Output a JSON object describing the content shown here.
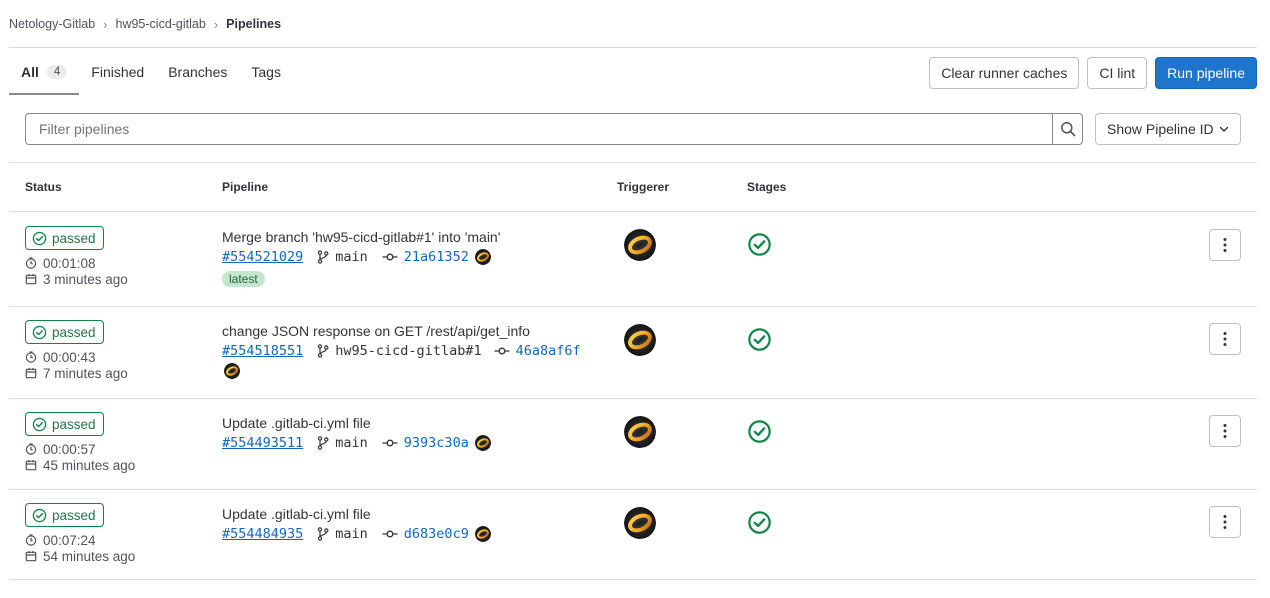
{
  "breadcrumb": [
    "Netology-Gitlab",
    "hw95-cicd-gitlab",
    "Pipelines"
  ],
  "tabs": [
    {
      "label": "All",
      "count": "4"
    },
    {
      "label": "Finished"
    },
    {
      "label": "Branches"
    },
    {
      "label": "Tags"
    }
  ],
  "actions": {
    "clear_caches": "Clear runner caches",
    "ci_lint": "CI lint",
    "run_pipeline": "Run pipeline"
  },
  "filter": {
    "placeholder": "Filter pipelines",
    "sort_label": "Show Pipeline ID"
  },
  "table": {
    "headers": [
      "Status",
      "Pipeline",
      "Triggerer",
      "Stages"
    ],
    "rows": [
      {
        "status": "passed",
        "duration": "00:01:08",
        "finished": "3 minutes ago",
        "title": "Merge branch 'hw95-cicd-gitlab#1' into 'main'",
        "id": "#554521029",
        "ref": "main",
        "sha": "21a61352",
        "badge": "latest"
      },
      {
        "status": "passed",
        "duration": "00:00:43",
        "finished": "7 minutes ago",
        "title": "change JSON response on GET /rest/api/get_info",
        "id": "#554518551",
        "ref": "hw95-cicd-gitlab#1",
        "sha": "46a8af6f"
      },
      {
        "status": "passed",
        "duration": "00:00:57",
        "finished": "45 minutes ago",
        "title": "Update .gitlab-ci.yml file",
        "id": "#554493511",
        "ref": "main",
        "sha": "9393c30a"
      },
      {
        "status": "passed",
        "duration": "00:07:24",
        "finished": "54 minutes ago",
        "title": "Update .gitlab-ci.yml file",
        "id": "#554484935",
        "ref": "main",
        "sha": "d683e0c9"
      }
    ]
  },
  "colors": {
    "success": "#108548",
    "link": "#1068bf",
    "primary": "#1f75cb"
  }
}
